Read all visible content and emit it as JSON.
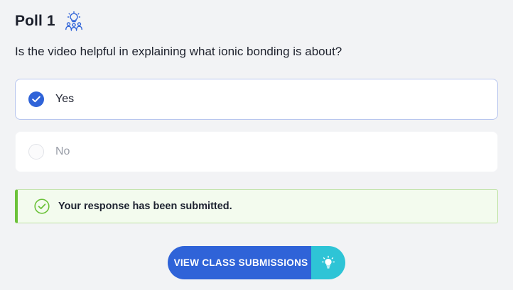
{
  "poll": {
    "title": "Poll 1",
    "header_icon": "group-idea-icon",
    "question": "Is the video helpful in explaining what ionic bonding is about?"
  },
  "options": [
    {
      "label": "Yes",
      "selected": true
    },
    {
      "label": "No",
      "selected": false
    }
  ],
  "status": {
    "message": "Your response has been submitted.",
    "icon": "check-circle-icon",
    "color": "#6cc23a"
  },
  "actions": {
    "view_submissions_label": "VIEW CLASS SUBMISSIONS",
    "view_submissions_icon": "lightbulb-icon"
  },
  "colors": {
    "primary": "#2f63d8",
    "accent": "#2ec4d6",
    "success": "#6cc23a"
  }
}
